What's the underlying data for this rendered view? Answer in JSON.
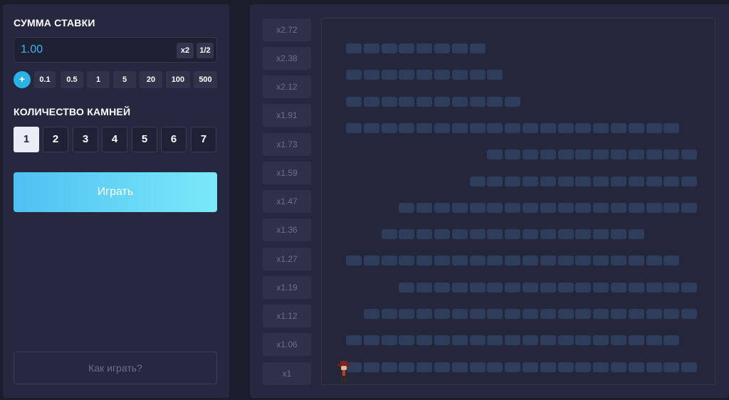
{
  "bet": {
    "title": "СУММА СТАВКИ",
    "value": "1.00",
    "double_label": "x2",
    "half_label": "1/2",
    "plus_label": "+",
    "chips": [
      "0.1",
      "0.5",
      "1",
      "5",
      "20",
      "100",
      "500"
    ]
  },
  "stones": {
    "title": "КОЛИЧЕСТВО КАМНЕЙ",
    "options": [
      "1",
      "2",
      "3",
      "4",
      "5",
      "6",
      "7"
    ],
    "selected": "1"
  },
  "play_label": "Играть",
  "howto_label": "Как играть?",
  "coefficients": [
    "x2.72",
    "x2.38",
    "x2.12",
    "x1.91",
    "x1.73",
    "x1.59",
    "x1.47",
    "x1.36",
    "x1.27",
    "x1.19",
    "x1.12",
    "x1.06",
    "x1"
  ],
  "colors": {
    "accent": "#2bb3e8",
    "bet_value": "#3fb2f0",
    "cell": "#2f3d5c",
    "panel": "#262840",
    "background": "#1b1c2c"
  },
  "icons": {
    "player": "adventurer-character-icon"
  }
}
